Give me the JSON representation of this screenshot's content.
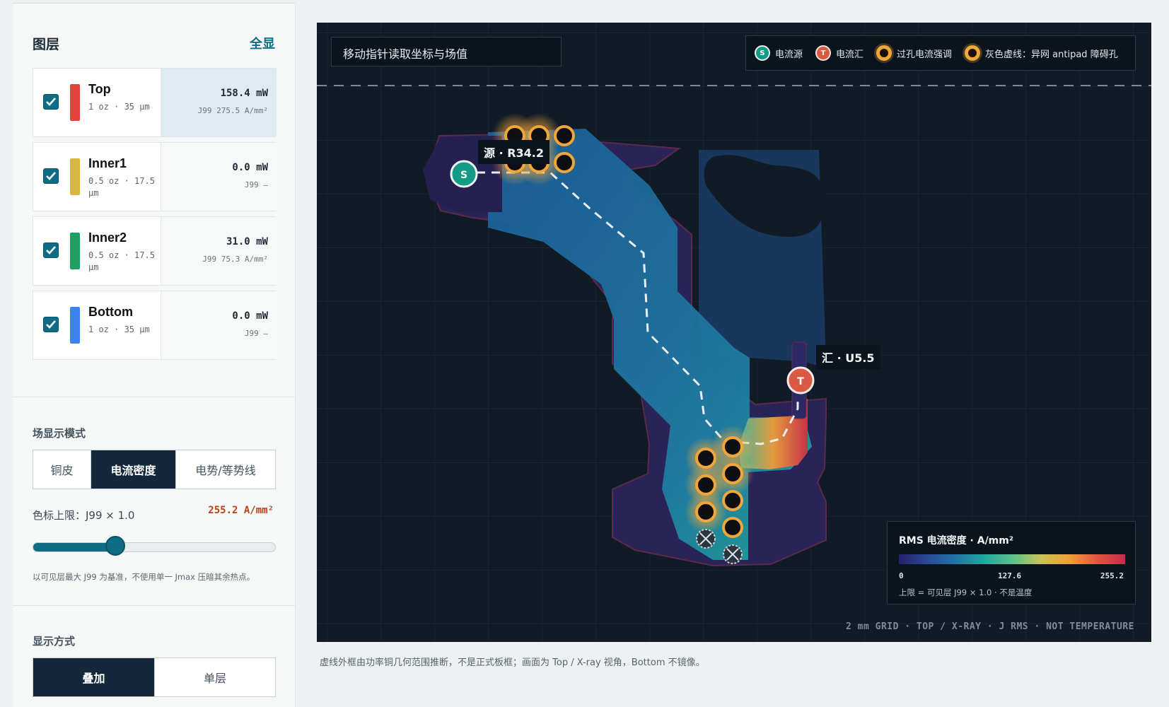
{
  "sidebar": {
    "title": "图层",
    "show_all": "全显",
    "layers": [
      {
        "name": "Top",
        "sub": "1 oz · 35 µm",
        "power": "158.4 mW",
        "j99": "J99 275.5 A/mm²",
        "color": "#e5423d",
        "active": true
      },
      {
        "name": "Inner1",
        "sub": "0.5 oz · 17.5 µm",
        "power": "0.0 mW",
        "j99": "J99 —",
        "color": "#d8b646",
        "active": false
      },
      {
        "name": "Inner2",
        "sub": "0.5 oz · 17.5 µm",
        "power": "31.0 mW",
        "j99": "J99 75.3 A/mm²",
        "color": "#1f9f62",
        "active": false
      },
      {
        "name": "Bottom",
        "sub": "1 oz · 35 µm",
        "power": "0.0 mW",
        "j99": "J99 —",
        "color": "#3c82f0",
        "active": false
      }
    ],
    "field_mode": {
      "title": "场显示模式",
      "options": [
        "铜皮",
        "电流密度",
        "电势/等势线"
      ],
      "selected": "电流密度"
    },
    "color_limit": {
      "label": "色标上限：J99 × 1.0",
      "value": "255.2 A/mm²",
      "slider_fraction": 0.34,
      "hint": "以可见层最大 J99 为基准，不使用单一 Jmax 压暗其余热点。"
    },
    "display_mode": {
      "title": "显示方式",
      "options": [
        "叠加",
        "单层"
      ],
      "selected": "叠加"
    }
  },
  "canvas": {
    "readout": "移动指针读取坐标与场值",
    "legend": [
      {
        "label": "电流源",
        "icon": "source-icon",
        "glyph": "S"
      },
      {
        "label": "电流汇",
        "icon": "sink-icon",
        "glyph": "T"
      },
      {
        "label": "过孔电流强调",
        "icon": "via-icon"
      },
      {
        "label": "灰色虚线：异网 antipad 障碍孔",
        "icon": "antipad-via-icon"
      }
    ],
    "source_tag": "源 · R34.2",
    "sink_tag": "汇 · U5.5",
    "source_glyph": "S",
    "sink_glyph": "T",
    "scale": {
      "title": "RMS 电流密度 · A/mm²",
      "min": "0",
      "mid": "127.6",
      "max": "255.2",
      "note": "上限 = 可见层 J99 × 1.0 · 不是温度"
    },
    "footer": "2 mm GRID · TOP / X-RAY · J RMS · NOT TEMPERATURE"
  },
  "caption": "虚线外框由功率铜几何范围推断，不是正式板框；画面为 Top / X-ray 视角，Bottom 不镜像。",
  "colors": {
    "accent": "#0e6c85",
    "dark": "#13283a",
    "warn": "#b2431c",
    "canvas_bg": "#111b25",
    "source": "#149a86",
    "sink": "#d95a44",
    "via": "#f0a63a"
  }
}
